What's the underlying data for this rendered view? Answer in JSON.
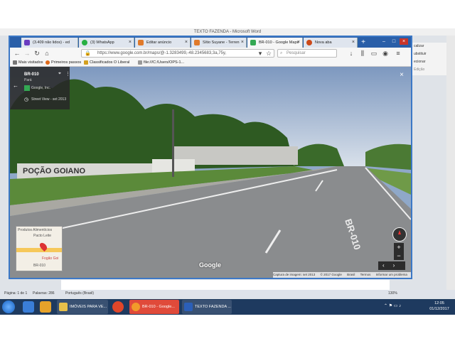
{
  "word": {
    "title": "TEXTO FAZENDA - Microsoft Word",
    "ribbon_right": [
      "calizar",
      "ubstituir",
      "ecionar",
      "Edição"
    ],
    "status": {
      "page": "Página: 1 de 1",
      "words": "Palavras: 286",
      "language": "Português (Brasil)",
      "zoom": "130%"
    }
  },
  "firefox": {
    "tabs": [
      {
        "label": "(3.409 não lidos) - ed",
        "color": "#6a3cc0"
      },
      {
        "label": "(3) WhatsApp",
        "color": "#27b043"
      },
      {
        "label": "Editar anúncio",
        "color": "#e07a2a"
      },
      {
        "label": "Sítio Suyane - Terren",
        "color": "#e07a2a"
      },
      {
        "label": "BR-010 - Google Maps",
        "color": "#34a853"
      },
      {
        "label": "Nova aba",
        "color": "#cc4a1a"
      }
    ],
    "active_tab": 4,
    "url": "https://www.google.com.br/maps/@-1.3283499,-48.2345683,3a,75y,",
    "search_placeholder": "Pesquisar",
    "bookmarks": [
      "Mais visitados",
      "Primeiros passos",
      "Classificados O Liberal",
      "file:///C:/Users/OPS-1..."
    ]
  },
  "streetview": {
    "road": "BR-010",
    "state": "Pará",
    "owner": "Google, Inc.",
    "date": "Street View - set 2013",
    "sign_text": "POÇÃO GOIANO",
    "road_paint": "BR-010",
    "map_label_1": "Produtos Alimentícios",
    "map_label_2": "Pacto Leite",
    "map_label_3": "Fogão Goi",
    "map_label_4": "BR-010",
    "google_logo": "Google",
    "footer": [
      "Captura de imagem: set 2013",
      "© 2017 Google",
      "Brasil",
      "Termos",
      "Informar um problema"
    ]
  },
  "taskbar": {
    "items": [
      {
        "label": "IMÓVEIS PARA VE...",
        "color": "#e8c04a"
      },
      {
        "label": "BR-010 - Google...",
        "color": "#e0462a"
      },
      {
        "label": "TEXTO FAZENDA ...",
        "color": "#2b5fb8"
      }
    ],
    "time": "12:05",
    "date": "01/12/2017"
  }
}
